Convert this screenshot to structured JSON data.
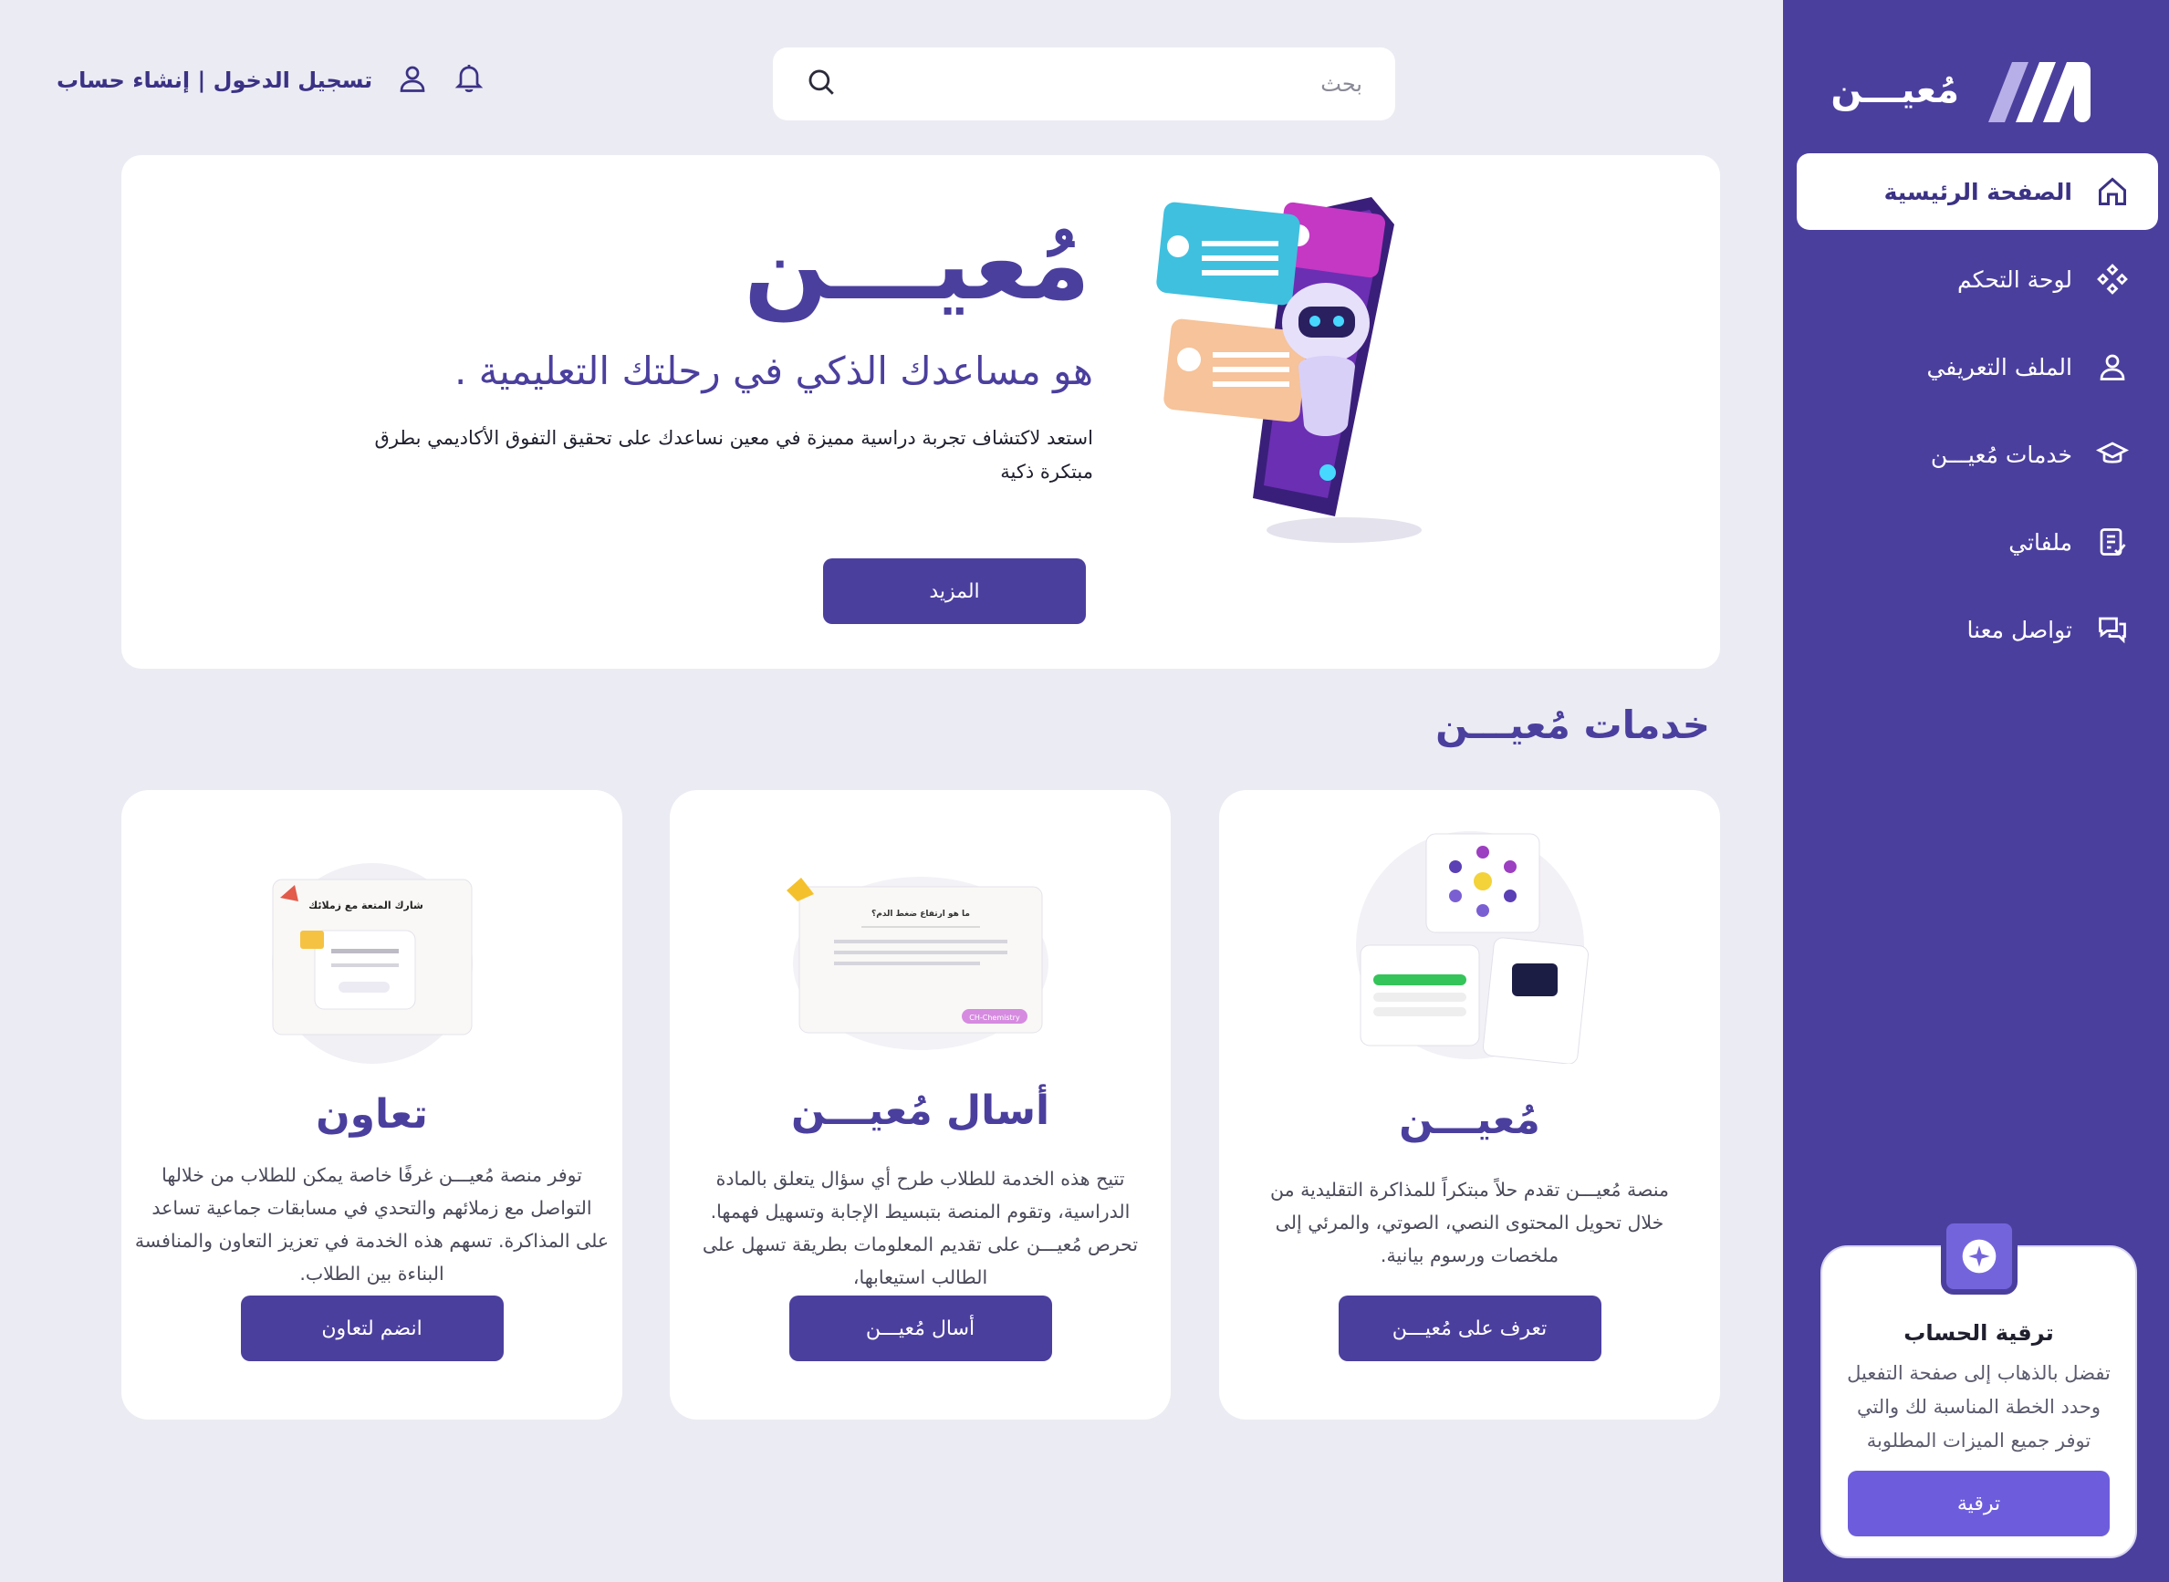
{
  "colors": {
    "primary": "#4b3f9e",
    "accent": "#6d5ddc",
    "background": "#ebebf3"
  },
  "sidebar": {
    "brand": "مُعيـــن",
    "items": [
      {
        "label": "الصفحة الرئيسية",
        "icon": "home-icon",
        "active": true
      },
      {
        "label": "لوحة التحكم",
        "icon": "dashboard-icon"
      },
      {
        "label": "الملف التعريفي",
        "icon": "user-icon"
      },
      {
        "label": "خدمات مُعيـــن",
        "icon": "graduation-cap-icon"
      },
      {
        "label": "ملفاتي",
        "icon": "document-icon"
      },
      {
        "label": "تواصل معنا",
        "icon": "chat-icon"
      }
    ],
    "upgrade": {
      "title": "ترقية الحساب",
      "text": "تفضل بالذهاب إلى صفحة التفعيل وحدد الخطة المناسبة لك والتي توفر جميع الميزات المطلوبة",
      "button": "ترقية",
      "icon": "sparkle-icon"
    }
  },
  "header": {
    "search_placeholder": "بحث",
    "auth": "تسجيل الدخول | إنشاء حساب"
  },
  "hero": {
    "title": "مُعيـــن",
    "subtitle": "هو مساعدك الذكي في رحلتك التعليمية .",
    "description": "استعد لاكتشاف تجربة دراسية مميزة في معين نساعدك على تحقيق التفوق الأكاديمي بطرق مبتكرة ذكية",
    "button": "المزيد"
  },
  "services": {
    "title": "خدمات مُعيـــن",
    "cards": [
      {
        "title": "مُعيـــن",
        "description": "منصة مُعيـــن تقدم حلاً مبتكراً للمذاكرة التقليدية من خلال تحويل المحتوى النصي، الصوتي، والمرئي إلى ملخصات ورسوم بيانية.",
        "button": "تعرف على مُعيـــن"
      },
      {
        "title": "أسال  مُعيـــن",
        "description": "تتيح هذه الخدمة للطلاب طرح أي سؤال يتعلق بالمادة الدراسية، وتقوم المنصة بتبسيط الإجابة وتسهيل فهمها. تحرص مُعيـــن على تقديم المعلومات بطريقة تسهل على الطالب استيعابها،",
        "button": "أسال مُعيـــن",
        "art": {
          "heading": "ما هو ارتفاع ضغط الدم؟",
          "tag": "CH-Chemistry"
        }
      },
      {
        "title": "تعاون",
        "description": "توفر منصة مُعيـــن غرفًا خاصة يمكن للطلاب من خلالها التواصل مع زملائهم والتحدي في مسابقات جماعية تساعد على المذاكرة. تسهم هذه الخدمة في تعزيز التعاون والمنافسة البناءة بين الطلاب.",
        "button": "انضم لتعاون",
        "art": {
          "heading": "شارك المتعة مع زملائك"
        }
      }
    ]
  }
}
